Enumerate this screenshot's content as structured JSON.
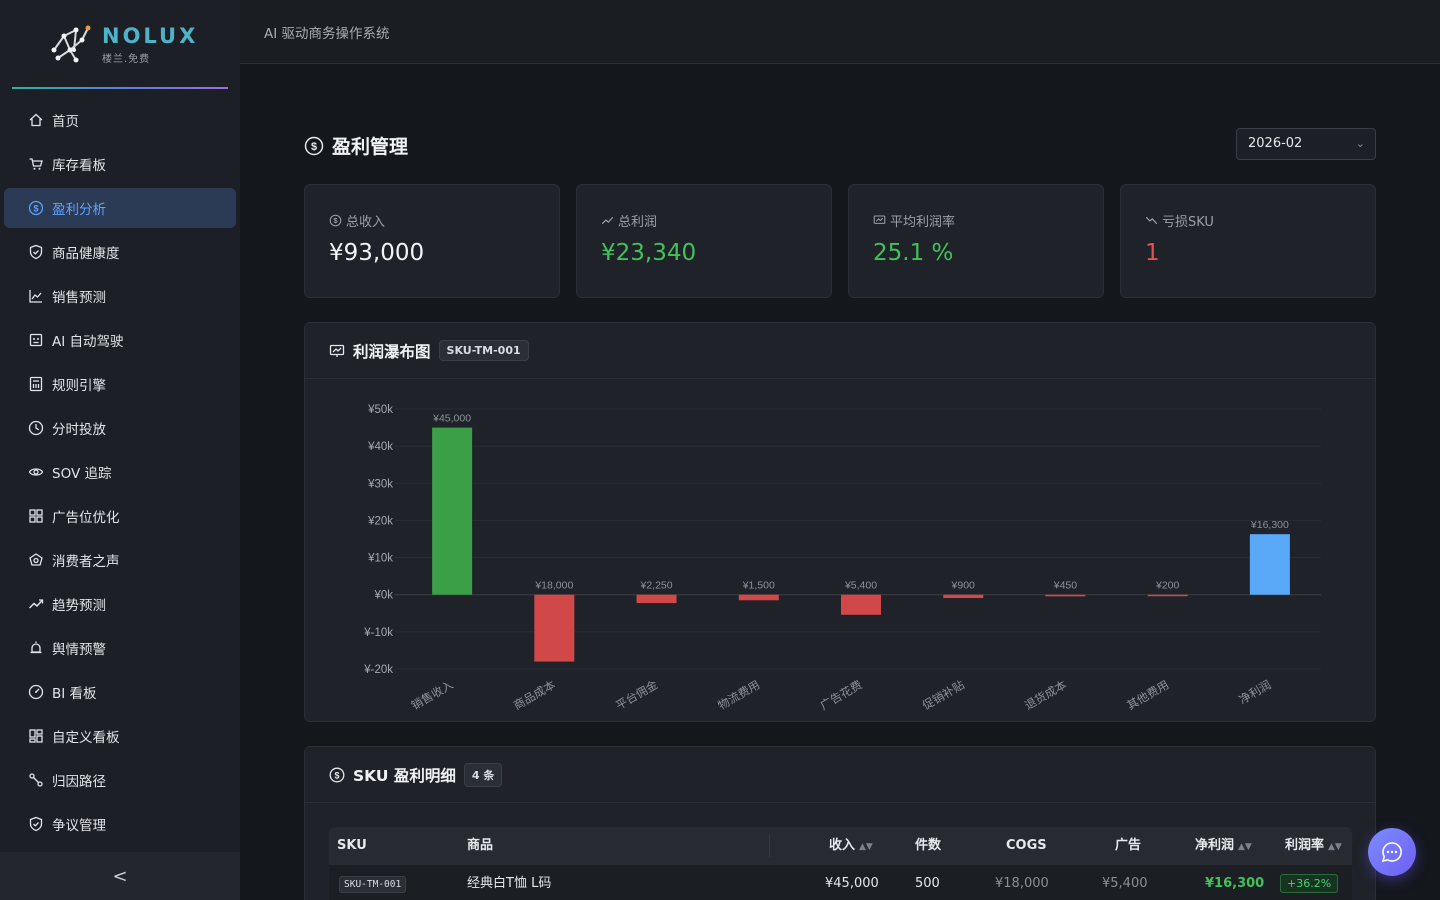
{
  "app": {
    "logo_title": "NOLUX",
    "logo_subtitle": "楼兰.免费",
    "header_title": "AI 驱动商务操作系统"
  },
  "sidebar": {
    "items": [
      {
        "label": "首页",
        "icon": "home-icon",
        "active": false
      },
      {
        "label": "库存看板",
        "icon": "cart-icon",
        "active": false
      },
      {
        "label": "盈利分析",
        "icon": "dollar-circle-icon",
        "active": true
      },
      {
        "label": "商品健康度",
        "icon": "shield-check-icon",
        "active": false
      },
      {
        "label": "销售预测",
        "icon": "line-chart-icon",
        "active": false
      },
      {
        "label": "AI 自动驾驶",
        "icon": "robot-icon",
        "active": false
      },
      {
        "label": "规则引擎",
        "icon": "calculator-icon",
        "active": false
      },
      {
        "label": "分时投放",
        "icon": "clock-icon",
        "active": false
      },
      {
        "label": "SOV 追踪",
        "icon": "eye-icon",
        "active": false
      },
      {
        "label": "广告位优化",
        "icon": "grid-icon",
        "active": false
      },
      {
        "label": "消费者之声",
        "icon": "sound-icon",
        "active": false
      },
      {
        "label": "趋势预测",
        "icon": "trend-up-icon",
        "active": false
      },
      {
        "label": "舆情预警",
        "icon": "alarm-icon",
        "active": false
      },
      {
        "label": "BI 看板",
        "icon": "dashboard-icon",
        "active": false
      },
      {
        "label": "自定义看板",
        "icon": "layout-icon",
        "active": false
      },
      {
        "label": "归因路径",
        "icon": "path-icon",
        "active": false
      },
      {
        "label": "争议管理",
        "icon": "shield-icon",
        "active": false
      }
    ],
    "collapse_symbol": "<"
  },
  "page": {
    "title": "盈利管理",
    "month": "2026-02"
  },
  "stats": [
    {
      "label": "总收入",
      "value": "¥93,000",
      "icon": "dollar-circle-icon",
      "tone": "default"
    },
    {
      "label": "总利润",
      "value": "¥23,340",
      "icon": "rise-icon",
      "tone": "green"
    },
    {
      "label": "平均利润率",
      "value": "25.1 %",
      "icon": "fund-icon",
      "tone": "green"
    },
    {
      "label": "亏损SKU",
      "value": "1",
      "icon": "fall-icon",
      "tone": "red"
    }
  ],
  "waterfall": {
    "title": "利润瀑布图",
    "sku_tag": "SKU-TM-001"
  },
  "chart_data": {
    "type": "bar",
    "title": "",
    "categories": [
      "销售收入",
      "商品成本",
      "平台佣金",
      "物流费用",
      "广告花费",
      "促销补贴",
      "退货成本",
      "其他费用",
      "净利润"
    ],
    "values": [
      45000,
      -18000,
      -2250,
      -1500,
      -5400,
      -900,
      -450,
      -200,
      16300
    ],
    "data_labels": [
      "¥45,000",
      "¥18,000",
      "¥2,250",
      "¥1,500",
      "¥5,400",
      "¥900",
      "¥450",
      "¥200",
      "¥16,300"
    ],
    "y_ticks": [
      "¥50k",
      "¥40k",
      "¥30k",
      "¥20k",
      "¥10k",
      "¥0k",
      "¥-10k",
      "¥-20k"
    ],
    "ylim": [
      -20000,
      50000
    ],
    "grid": true,
    "colors": {
      "positive": "#3a9f47",
      "negative": "#d04848",
      "total": "#5aa8f8"
    }
  },
  "sku_table": {
    "title": "SKU 盈利明细",
    "count_tag": "4 条",
    "columns": [
      "SKU",
      "商品",
      "收入",
      "件数",
      "COGS",
      "广告",
      "净利润",
      "利润率"
    ],
    "rows": [
      {
        "sku": "SKU-TM-001",
        "product": "经典白T恤 L码",
        "revenue": "¥45,000",
        "units": "500",
        "cogs": "¥18,000",
        "ad": "¥5,400",
        "net": "¥16,300",
        "margin": "+36.2%"
      }
    ]
  }
}
